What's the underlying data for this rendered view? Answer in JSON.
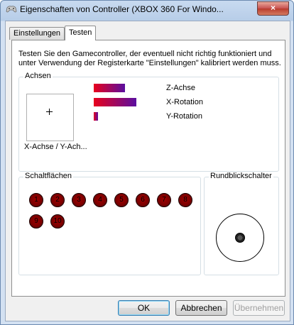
{
  "window": {
    "title": "Eigenschaften von Controller (XBOX 360 For Windo...",
    "close_glyph": "×",
    "app_icon": "gamecontroller-icon"
  },
  "tabs": [
    {
      "label": "Einstellungen",
      "active": false
    },
    {
      "label": "Testen",
      "active": true
    }
  ],
  "intro_text": "Testen Sie den Gamecontroller, der eventuell nicht richtig funktioniert und unter Verwendung der Registerkarte \"Einstellungen\" kalibriert werden muss.",
  "axes": {
    "group_label": "Achsen",
    "xy_label": "X-Achse / Y-Ach...",
    "crosshair": "+",
    "bars": [
      {
        "label": "Z-Achse",
        "level": 0.43
      },
      {
        "label": "X-Rotation",
        "level": 0.58
      },
      {
        "label": "Y-Rotation",
        "level": 0.06
      }
    ],
    "bar_colors": {
      "start": "#e8001c",
      "end": "#5a0fa0"
    }
  },
  "buttons_group": {
    "label": "Schaltflächen",
    "buttons": [
      "1",
      "2",
      "3",
      "4",
      "5",
      "6",
      "7",
      "8",
      "9",
      "10"
    ]
  },
  "pov": {
    "label": "Rundblickschalter"
  },
  "footer": {
    "ok": "OK",
    "cancel": "Abbrechen",
    "apply": "Übernehmen"
  }
}
